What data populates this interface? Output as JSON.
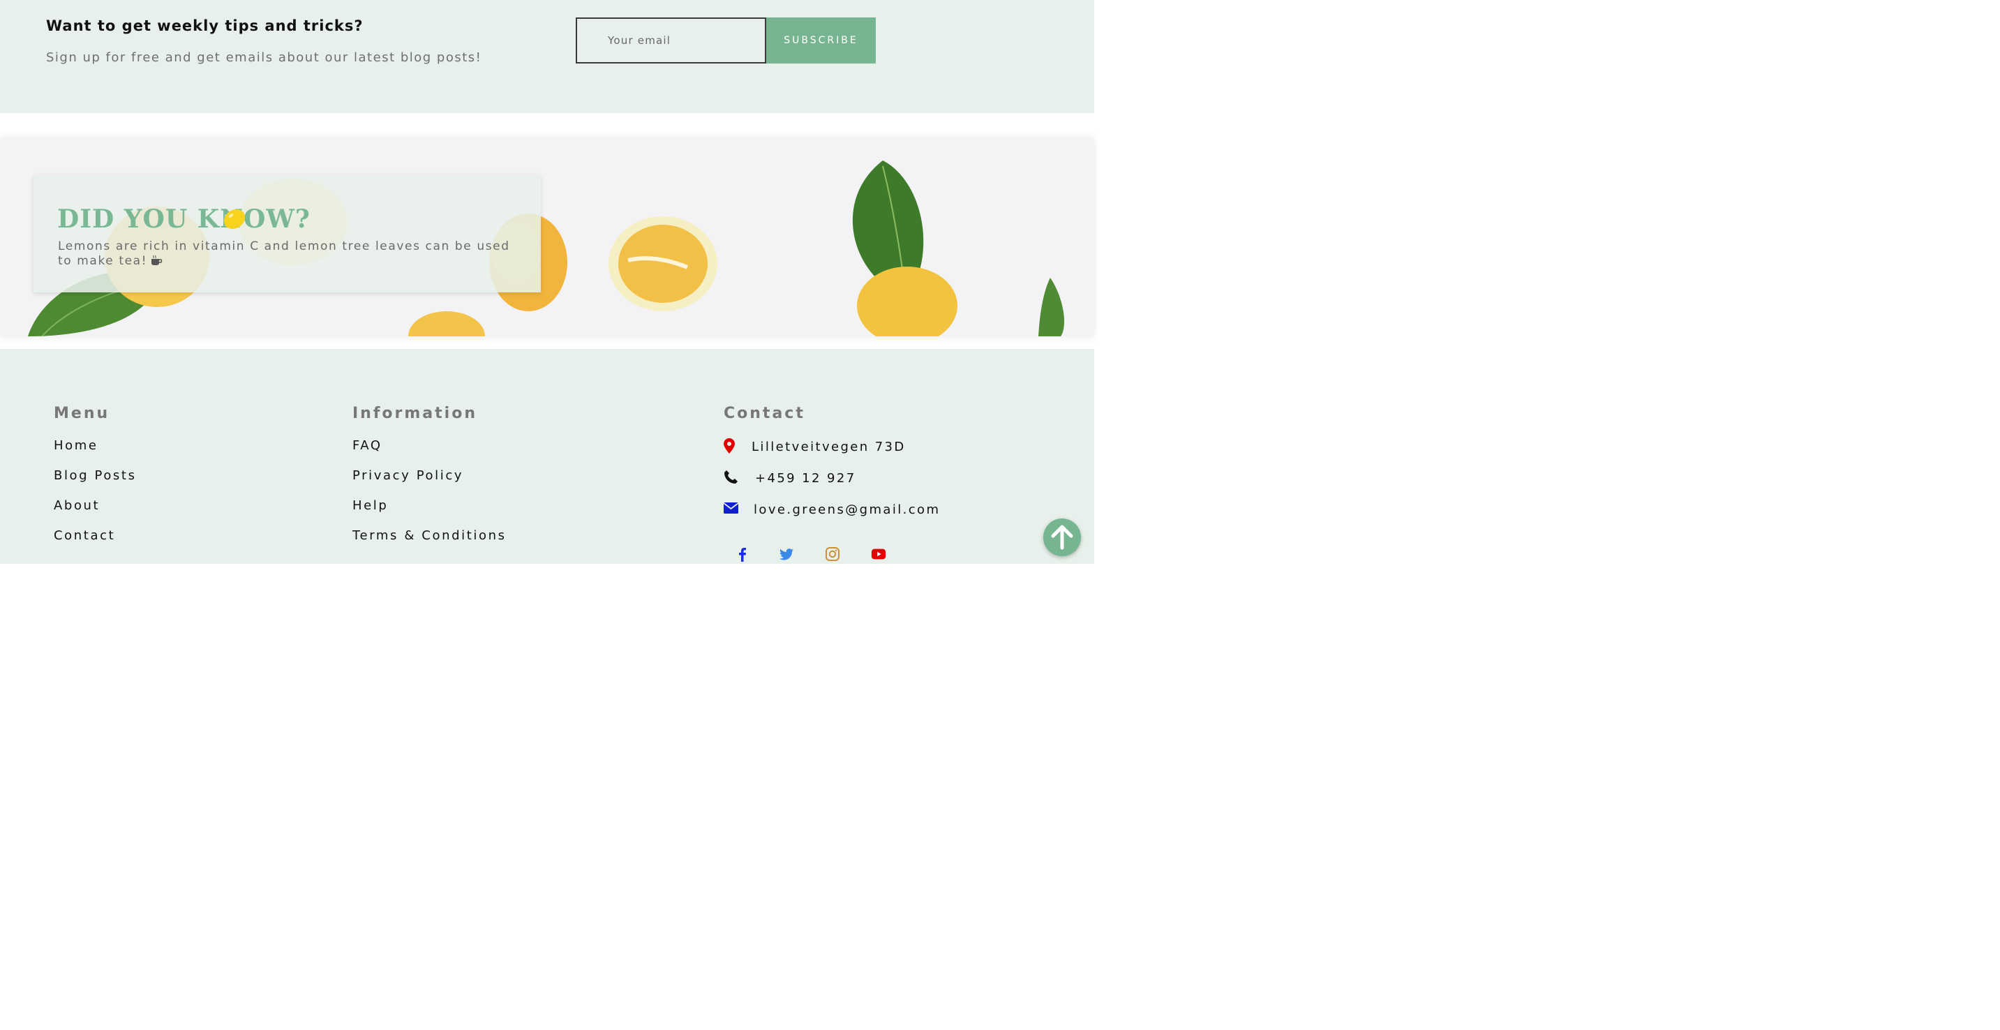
{
  "newsletter": {
    "heading": "Want to get weekly tips and tricks?",
    "subtext": "Sign up for free and get emails about our latest blog posts!",
    "email_placeholder": "Your email",
    "subscribe_label": "SUBSCRIBE"
  },
  "fact": {
    "title": "DID YOU KNOW?",
    "text": "Lemons are rich in vitamin C and lemon tree leaves can be used to make tea!",
    "title_icon": "lemon-icon",
    "text_icon": "coffee-cup-icon"
  },
  "footer": {
    "menu": {
      "title": "Menu",
      "links": [
        "Home",
        "Blog Posts",
        "About",
        "Contact"
      ]
    },
    "information": {
      "title": "Information",
      "links": [
        "FAQ",
        "Privacy Policy",
        "Help",
        "Terms & Conditions"
      ]
    },
    "contact": {
      "title": "Contact",
      "address": "Lilletveitvegen 73D",
      "phone": "+459 12 927",
      "email": "love.greens@gmail.com"
    },
    "social": [
      "facebook-icon",
      "twitter-icon",
      "instagram-icon",
      "youtube-icon"
    ]
  },
  "colors": {
    "accent": "#76b590",
    "background": "#e8f0eb",
    "map_pin": "#e00000",
    "email_icon": "#1020d0",
    "facebook": "#1a2ee0",
    "twitter": "#3b8ae8",
    "instagram": "#c9923a",
    "youtube": "#e00000"
  }
}
